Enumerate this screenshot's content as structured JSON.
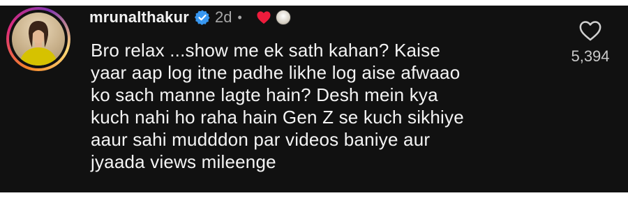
{
  "comment": {
    "username": "mrunalthakur",
    "time": "2d",
    "separator": "•",
    "text": "Bro relax ...show me ek sath kahan? Kaise\nyaar aap log itne padhe likhe log aise afwaao\nko sach manne lagte hain? Desh mein  kya\nkuch nahi ho raha hain Gen Z se kuch sikhiye\naaur sahi mudddon par videos baniye aur\njyaada views mileenge",
    "like_count": "5,394"
  },
  "icons": {
    "verified": "verified-badge-icon",
    "creator_heart": "red-heart-icon",
    "creator_avatar": "small-avatar",
    "like": "heart-outline-icon"
  },
  "colors": {
    "background": "#111111",
    "verified_blue": "#3897f0",
    "heart_red": "#ed1c3c",
    "text": "#f4f4f4",
    "muted": "#a8a8a8"
  }
}
